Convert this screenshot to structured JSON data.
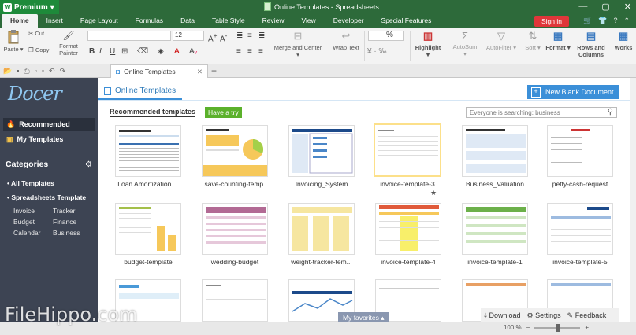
{
  "titlebar": {
    "premium": "Premium",
    "window_title": "Online Templates - Spreadsheets",
    "window_buttons": [
      "—",
      "▢",
      "✕"
    ]
  },
  "menu": {
    "tabs": [
      "Home",
      "Insert",
      "Page Layout",
      "Formulas",
      "Data",
      "Table Style",
      "Review",
      "View",
      "Developer",
      "Special Features"
    ],
    "signin": "Sign in"
  },
  "ribbon": {
    "paste": "Paste",
    "cut": "Cut",
    "copy": "Copy",
    "format_painter": "Format Painter",
    "font_size": "12",
    "merge_center": "Merge and Center",
    "wrap_text": "Wrap Text",
    "highlight": "Highlight",
    "autosum": "AutoSum",
    "autofilter": "AutoFilter",
    "sort": "Sort",
    "format": "Format",
    "rows_columns": "Rows and Columns",
    "works": "Works"
  },
  "doc_tab": {
    "label": "Online Templates"
  },
  "sidebar": {
    "logo": "Docer",
    "recommended": "Recommended",
    "my_templates": "My Templates",
    "categories": "Categories",
    "all_templates": "All Templates",
    "spreadsheets_template": "Spreadsheets Template",
    "sub": [
      "Invoice",
      "Tracker",
      "Budget",
      "Finance",
      "Calendar",
      "Business"
    ]
  },
  "content": {
    "online_templates_tab": "Online Templates",
    "new_blank": "New Blank Document",
    "recommended_templates": "Recommended templates",
    "have_a_try": "Have a try",
    "search_placeholder": "Everyone is searching: business",
    "templates_row1": [
      "Loan Amortization ...",
      "save-counting-temp.",
      "Invoicing_System",
      "invoice-template-3",
      "Business_Valuation",
      "petty-cash-request"
    ],
    "templates_row2": [
      "budget-template",
      "wedding-budget",
      "weight-tracker-tem...",
      "invoice-template-4",
      "invoice-template-1",
      "invoice-template-5"
    ],
    "my_favorites": "My favorites",
    "download": "Download",
    "settings": "Settings",
    "feedback": "Feedback"
  },
  "status": {
    "zoom": "100 %"
  },
  "watermark": "FileHippo.com"
}
